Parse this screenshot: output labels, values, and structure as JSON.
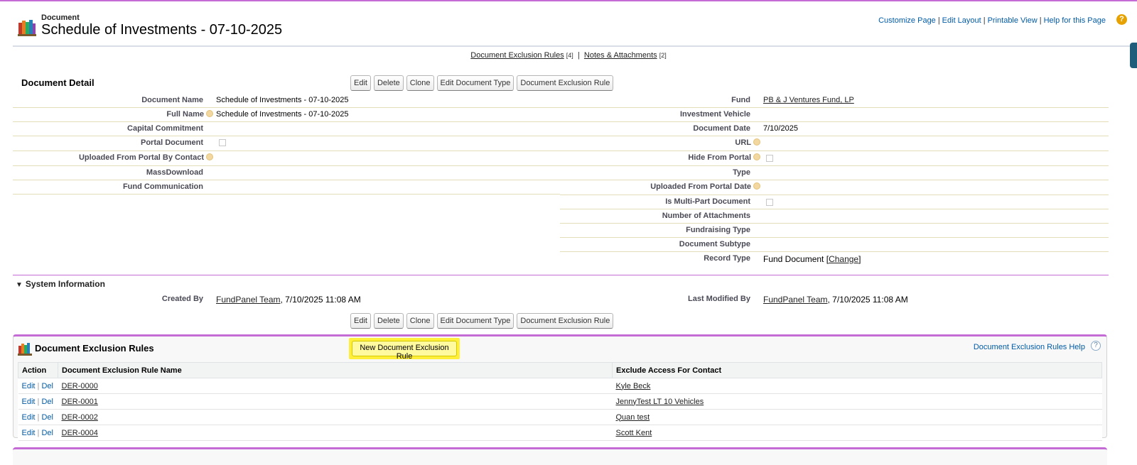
{
  "header": {
    "object_type": "Document",
    "title": "Schedule of Investments - 07-10-2025",
    "links": [
      "Customize Page",
      "Edit Layout",
      "Printable View",
      "Help for this Page"
    ],
    "help_icon": "question-icon"
  },
  "related_links": {
    "item1_label": "Document Exclusion Rules",
    "item1_count": "[4]",
    "separator": "|",
    "item2_label": "Notes & Attachments",
    "item2_count": "[2]"
  },
  "detail": {
    "section_title": "Document Detail",
    "buttons": [
      "Edit",
      "Delete",
      "Clone",
      "Edit Document Type",
      "Document Exclusion Rule"
    ],
    "left_fields": [
      {
        "label": "Document Name",
        "value": "Schedule of Investments - 07-10-2025"
      },
      {
        "label": "Full Name",
        "value": "Schedule of Investments - 07-10-2025"
      },
      {
        "label": "Capital Commitment",
        "value": ""
      },
      {
        "label": "Portal Document",
        "value": ""
      },
      {
        "label": "Uploaded From Portal By Contact",
        "value": ""
      },
      {
        "label": "MassDownload",
        "value": ""
      },
      {
        "label": "Fund Communication",
        "value": ""
      }
    ],
    "right_fields": [
      {
        "label": "Fund",
        "value": "PB & J Ventures Fund, LP"
      },
      {
        "label": "Investment Vehicle",
        "value": ""
      },
      {
        "label": "Document Date",
        "value": "7/10/2025"
      },
      {
        "label": "URL",
        "value": ""
      },
      {
        "label": "Hide From Portal",
        "value": ""
      },
      {
        "label": "Type",
        "value": ""
      },
      {
        "label": "Uploaded From Portal Date",
        "value": ""
      },
      {
        "label": "Is Multi-Part Document",
        "value": ""
      },
      {
        "label": "Number of Attachments",
        "value": ""
      },
      {
        "label": "Fundraising Type",
        "value": ""
      },
      {
        "label": "Document Subtype",
        "value": ""
      },
      {
        "label": "Record Type",
        "value": "Fund Document",
        "change_open": " [",
        "change_link": "Change",
        "change_close": "]"
      }
    ]
  },
  "system_info": {
    "title": "System Information",
    "created_by_label": "Created By",
    "created_by_user": "FundPanel Team",
    "created_by_date": ", 7/10/2025 11:08 AM",
    "modified_by_label": "Last Modified By",
    "modified_by_user": "FundPanel Team",
    "modified_by_date": ", 7/10/2025 11:08 AM"
  },
  "related_list": {
    "title": "Document Exclusion Rules",
    "new_button": "New Document Exclusion Rule",
    "help_link": "Document Exclusion Rules Help",
    "help_icon_text": "?",
    "columns": [
      "Action",
      "Document Exclusion Rule Name",
      "Exclude Access For Contact"
    ],
    "action_edit": "Edit",
    "action_sep": "|",
    "action_del": "Del",
    "rows": [
      {
        "name": "DER-0000",
        "contact": "Kyle Beck"
      },
      {
        "name": "DER-0001",
        "contact": "JennyTest LT 10 Vehicles"
      },
      {
        "name": "DER-0002",
        "contact": "Quan test"
      },
      {
        "name": "DER-0004",
        "contact": "Scott Kent"
      }
    ]
  },
  "colors": {
    "accent_border": "#c46bd6",
    "link": "#015ba7",
    "highlight": "#ffef3a"
  }
}
